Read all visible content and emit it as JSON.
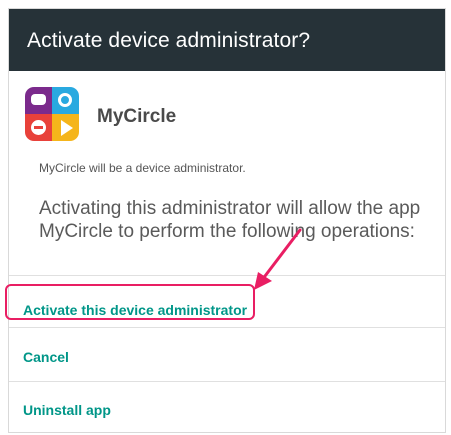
{
  "dialog": {
    "title": "Activate device administrator?",
    "app_name": "MyCircle",
    "app_icon": "mycircle-app-icon",
    "summary": "MyCircle will be a device administrator.",
    "description": "Activating this administrator will allow the app MyCircle to perform the following operations:",
    "actions": {
      "activate": "Activate this device administrator",
      "cancel": "Cancel",
      "uninstall": "Uninstall app"
    }
  },
  "colors": {
    "titlebar": "#263238",
    "action_text": "#009688",
    "annotation": "#e91e63"
  }
}
